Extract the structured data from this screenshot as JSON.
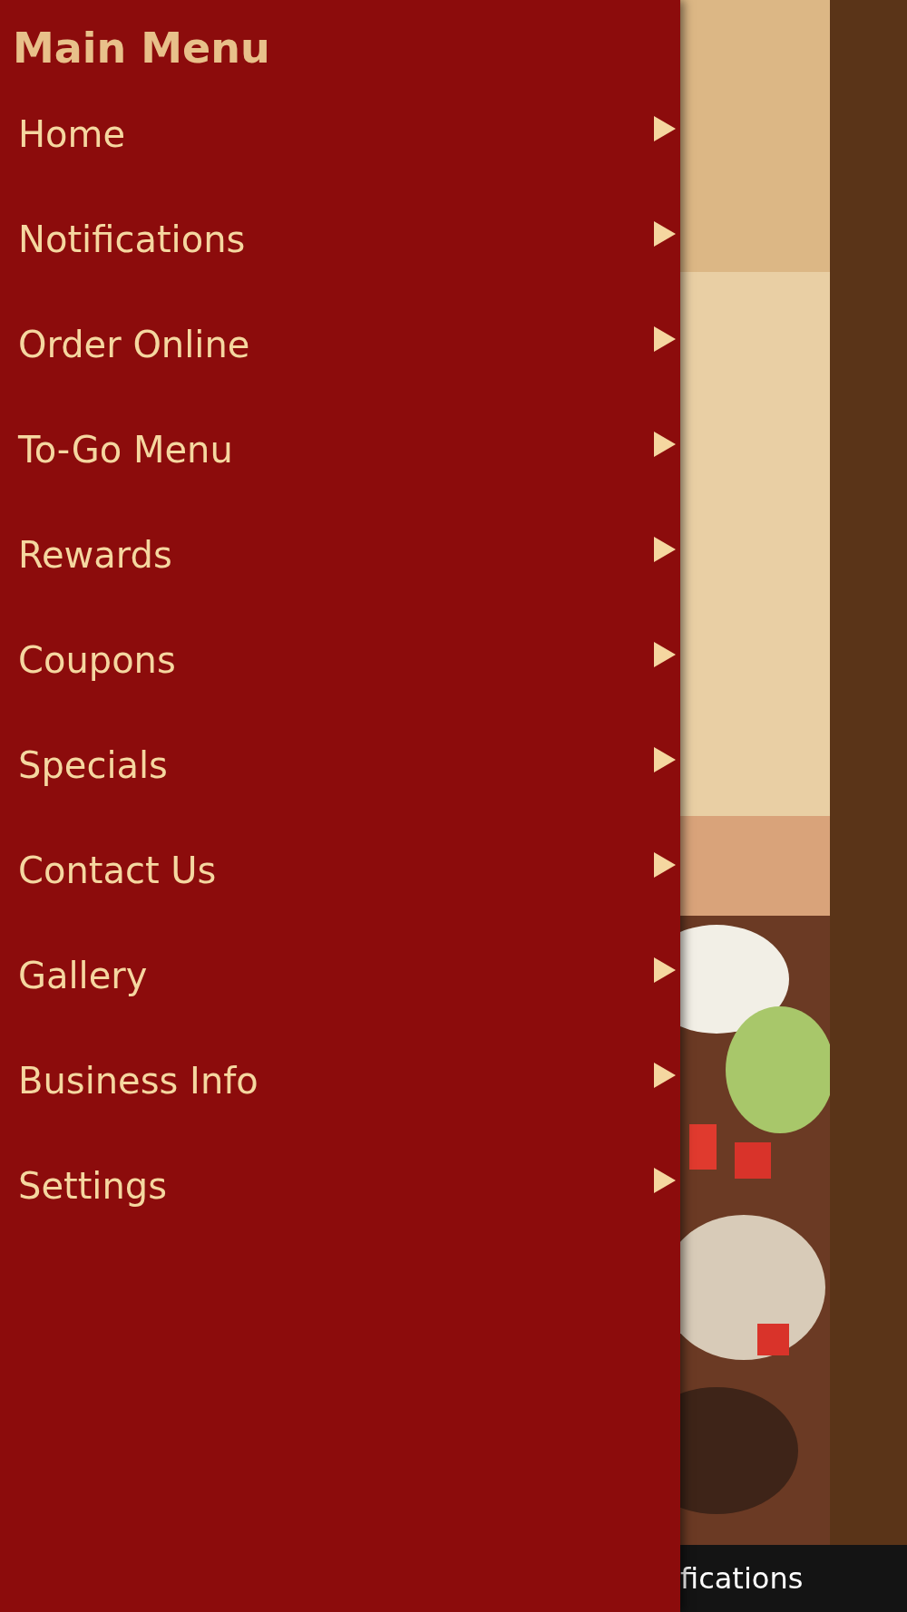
{
  "drawer": {
    "title": "Main Menu",
    "items": [
      {
        "label": "Home"
      },
      {
        "label": "Notifications"
      },
      {
        "label": "Order Online"
      },
      {
        "label": "To-Go Menu"
      },
      {
        "label": "Rewards"
      },
      {
        "label": "Coupons"
      },
      {
        "label": "Specials"
      },
      {
        "label": "Contact Us"
      },
      {
        "label": "Gallery"
      },
      {
        "label": "Business Info"
      },
      {
        "label": "Settings"
      }
    ]
  },
  "bottom_bar": {
    "label": "fications"
  }
}
